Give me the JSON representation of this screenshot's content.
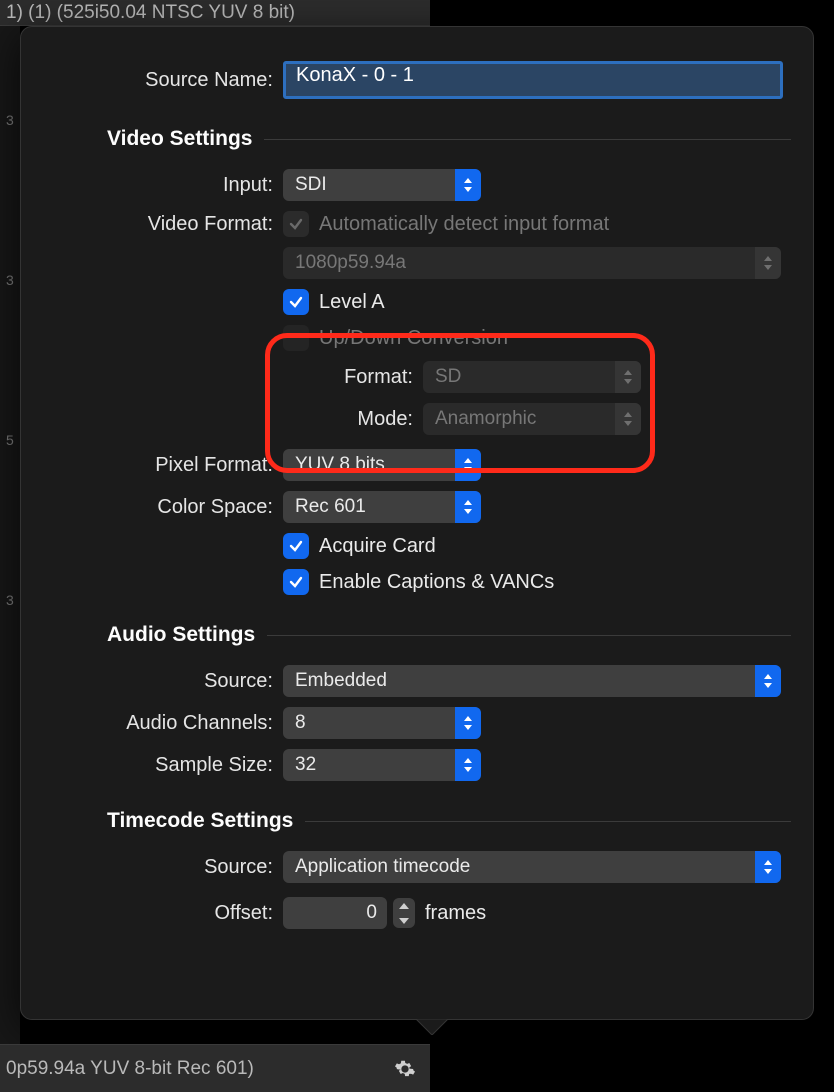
{
  "top_strip_text": "1) (1) (525i50.04 NTSC YUV 8 bit)",
  "footer_text": "0p59.94a YUV 8-bit Rec 601)",
  "side_ticks": [
    "3",
    "3",
    "5",
    "3"
  ],
  "source_name": {
    "label": "Source Name:",
    "value": "KonaX - 0 - 1"
  },
  "sections": {
    "video": {
      "title": "Video Settings"
    },
    "audio": {
      "title": "Audio Settings"
    },
    "tc": {
      "title": "Timecode Settings"
    }
  },
  "video": {
    "input": {
      "label": "Input:",
      "value": "SDI"
    },
    "format": {
      "label": "Video Format:",
      "auto_label": "Automatically detect input format",
      "value": "1080p59.94a",
      "level_a_label": "Level A",
      "level_a": true,
      "updown_label": "Up/Down Conversion",
      "updown": false,
      "conv_format": {
        "label": "Format:",
        "value": "SD"
      },
      "conv_mode": {
        "label": "Mode:",
        "value": "Anamorphic"
      }
    },
    "pixel_format": {
      "label": "Pixel Format:",
      "value": "YUV 8 bits"
    },
    "color_space": {
      "label": "Color Space:",
      "value": "Rec 601"
    },
    "acquire": {
      "label": "Acquire Card",
      "checked": true
    },
    "captions": {
      "label": "Enable Captions & VANCs",
      "checked": true
    }
  },
  "audio": {
    "source": {
      "label": "Source:",
      "value": "Embedded"
    },
    "channels": {
      "label": "Audio Channels:",
      "value": "8"
    },
    "sample": {
      "label": "Sample Size:",
      "value": "32"
    }
  },
  "tc": {
    "source": {
      "label": "Source:",
      "value": "Application timecode"
    },
    "offset": {
      "label": "Offset:",
      "value": "0",
      "unit": "frames"
    }
  }
}
